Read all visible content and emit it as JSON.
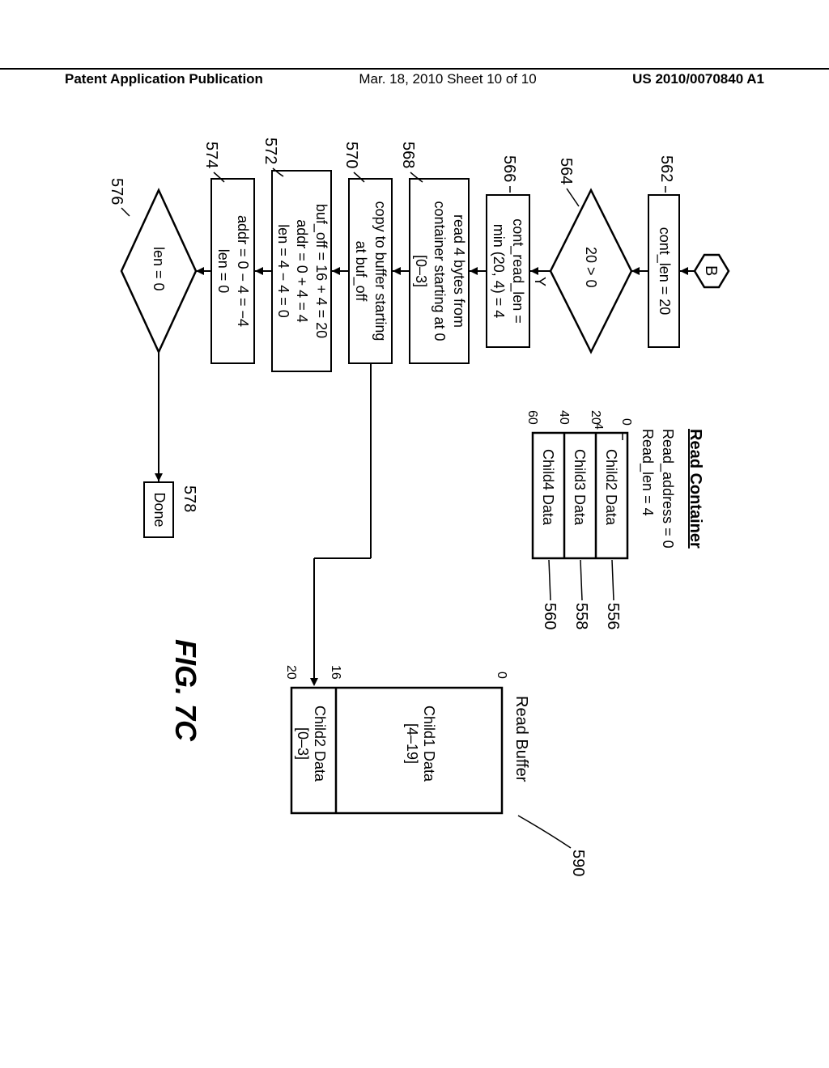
{
  "header": {
    "left": "Patent Application Publication",
    "center": "Mar. 18, 2010  Sheet 10 of 10",
    "right": "US 2010/0070840 A1"
  },
  "flow": {
    "start": "B",
    "b562": "cont_len = 20",
    "d564_cond": "20 > 0",
    "d564_yes": "Y",
    "b566": "cont_read_len =\nmin (20, 4) = 4",
    "b568": "read 4 bytes from\ncontainer starting at 0\n[0–3]",
    "b570": "copy to buffer starting\nat buf_off",
    "b572": "buf_off = 16 + 4 = 20\naddr = 0 + 4 = 4\nlen = 4 − 4 = 0",
    "b574": "addr = 0 − 4 = −4\nlen = 0",
    "d576_cond": "len = 0",
    "b578": "Done"
  },
  "refs": {
    "r562": "562",
    "r564": "564",
    "r566": "566",
    "r568": "568",
    "r570": "570",
    "r572": "572",
    "r574": "574",
    "r576": "576",
    "r578": "578",
    "r556": "556",
    "r558": "558",
    "r560": "560",
    "r590": "590"
  },
  "container": {
    "title": "Read Container",
    "addr": "Read_address = 0",
    "len": "Read_len = 4",
    "sub4": "4",
    "t0": "0",
    "t20": "20",
    "t40": "40",
    "t60": "60",
    "c2": "Child2 Data",
    "c3": "Child3 Data",
    "c4": "Child4 Data"
  },
  "buffer": {
    "title": "Read Buffer",
    "t0": "0",
    "t16": "16",
    "t20": "20",
    "c1": "Child1 Data\n[4–19]",
    "c2": "Child2 Data\n[0–3]"
  },
  "fig": "FIG. 7C"
}
